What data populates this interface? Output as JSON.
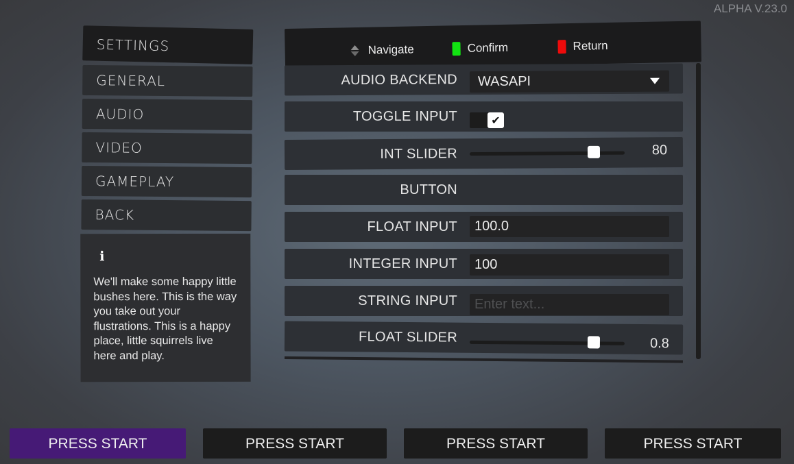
{
  "version": "ALPHA V.23.0",
  "sidebar": {
    "title": "SETTINGS",
    "items": [
      {
        "label": "GENERAL"
      },
      {
        "label": "AUDIO"
      },
      {
        "label": "VIDEO"
      },
      {
        "label": "GAMEPLAY"
      },
      {
        "label": "BACK"
      }
    ],
    "info": {
      "icon": "info-icon",
      "text": "We'll make some happy little bushes here. This is the way you take out your flustrations. This is a happy place, little squirrels live here and play."
    }
  },
  "hints": [
    {
      "icon": "dpad-updown-icon",
      "label": "Navigate"
    },
    {
      "icon": "confirm-button-icon",
      "label": "Confirm",
      "color": "#12e312"
    },
    {
      "icon": "return-button-icon",
      "label": "Return",
      "color": "#ee0b0b"
    }
  ],
  "settings": {
    "audio_backend": {
      "label": "AUDIO BACKEND",
      "value": "WASAPI"
    },
    "toggle_input": {
      "label": "TOGGLE INPUT",
      "checked": true,
      "check_glyph": "✔"
    },
    "int_slider": {
      "label": "INT SLIDER",
      "value": "80",
      "fraction": 0.8
    },
    "button": {
      "label": "BUTTON"
    },
    "float_input": {
      "label": "FLOAT INPUT",
      "value": "100.0"
    },
    "integer_input": {
      "label": "INTEGER INPUT",
      "value": "100"
    },
    "string_input": {
      "label": "STRING INPUT",
      "value": "",
      "placeholder": "Enter text..."
    },
    "float_slider": {
      "label": "FLOAT SLIDER",
      "value": "0.8",
      "fraction": 0.8
    }
  },
  "players": [
    {
      "label": "PRESS START",
      "active": true,
      "color": "#461a76"
    },
    {
      "label": "PRESS START",
      "active": false
    },
    {
      "label": "PRESS START",
      "active": false
    },
    {
      "label": "PRESS START",
      "active": false
    }
  ]
}
